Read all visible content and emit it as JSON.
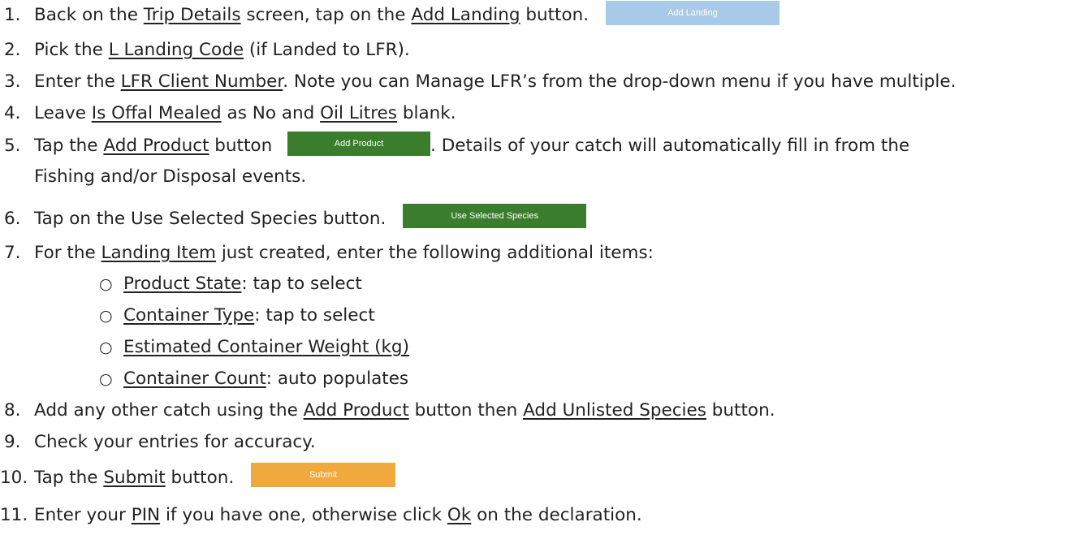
{
  "steps": [
    {
      "num": "1.",
      "parts": [
        "Back on the ",
        "Trip Details",
        " screen, tap on the ",
        "Add Landing",
        " button."
      ],
      "button": "Add Landing"
    },
    {
      "num": "2.",
      "parts": [
        "Pick the ",
        "L Landing Code",
        " (if Landed to LFR)."
      ]
    },
    {
      "num": "3.",
      "parts": [
        "Enter the ",
        "LFR Client Number",
        ". Note you can Manage LFR’s from the drop-down menu if you have multiple."
      ]
    },
    {
      "num": "4.",
      "parts": [
        "Leave ",
        "Is Offal Mealed",
        " as No and ",
        "Oil Litres",
        " blank."
      ]
    },
    {
      "num": "5.",
      "parts": [
        "Tap the ",
        "Add Product",
        " button",
        ". Details of your catch will automatically fill in from the"
      ],
      "button": "Add Product",
      "cont": "Fishing and/or Disposal events."
    },
    {
      "num": "6.",
      "parts": [
        "Tap on the Use Selected Species button."
      ],
      "button": "Use Selected Species"
    },
    {
      "num": "7.",
      "parts": [
        "For the ",
        "Landing Item",
        " just created, enter the following additional items:"
      ]
    },
    {
      "num": "8.",
      "parts": [
        "Add any other catch using the ",
        "Add Product",
        " button then ",
        "Add Unlisted Species",
        " button."
      ]
    },
    {
      "num": "9.",
      "parts": [
        "Check your entries for accuracy."
      ]
    },
    {
      "num": "10.",
      "parts": [
        "Tap the ",
        "Submit",
        " button."
      ],
      "button": "Submit"
    },
    {
      "num": "11.",
      "parts": [
        "Enter your ",
        "PIN",
        " if you have one, otherwise click ",
        "Ok",
        " on the declaration."
      ]
    }
  ],
  "sub_items": [
    {
      "bullet": "○",
      "link": "Product State",
      "rest": ": tap to select"
    },
    {
      "bullet": "○",
      "link": "Container Type",
      "rest": ": tap to select"
    },
    {
      "bullet": "○",
      "link": "Estimated Container Weight (kg)",
      "rest": ""
    },
    {
      "bullet": "○",
      "link": "Container Count",
      "rest": ": auto populates"
    }
  ],
  "colors": {
    "add_landing_button": "#a9c9e9",
    "green_button": "#3a7d2c",
    "submit_button": "#f0a93c",
    "text": "#222222"
  }
}
